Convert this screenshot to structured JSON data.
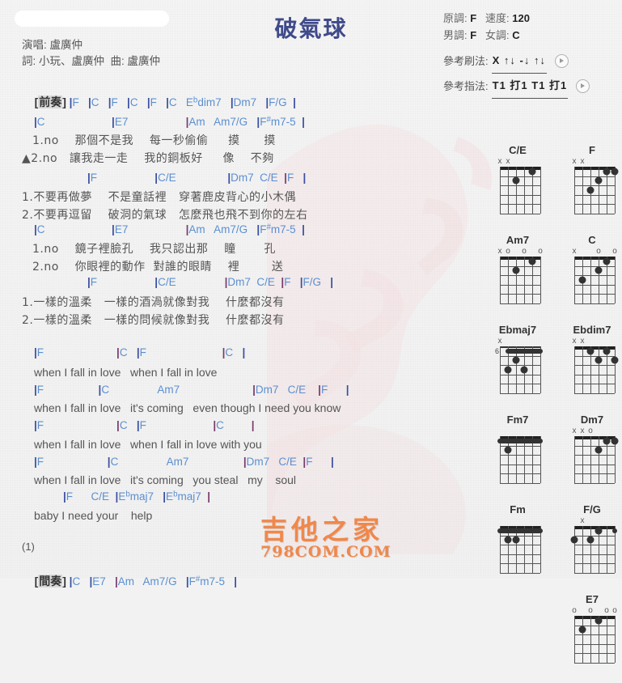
{
  "header": {
    "title": "破氣球",
    "redacted_bar": "",
    "credits": [
      "演唱: 盧廣仲",
      "詞: 小玩、盧廣仲  曲: 盧廣仲"
    ],
    "meta": [
      {
        "label1": "原調:",
        "value1": "F",
        "label2": "速度:",
        "value2": "120"
      },
      {
        "label1": "男調:",
        "value1": "F",
        "label2": "女調:",
        "value2": "C"
      }
    ],
    "strum": {
      "label": "參考刷法:",
      "pattern": "X ↑↓ -↓ ↑↓",
      "play_icon": "play-icon"
    },
    "fingerstyle": {
      "label": "參考指法:",
      "pattern": "T1 打1 T1 打1",
      "play_icon": "play-icon"
    }
  },
  "sections": {
    "intro": {
      "label": "[前奏]",
      "chords": "|F   |C   |F   |C   |F   |C   E♭dim7   |Dm7   |F/G   |"
    },
    "verse1": {
      "line1_chords": "|C                |E7             |Am   Am7/G   |F♯m7-5  |",
      "line1_lyrics": [
        "1.no    那個不是我    每一秒偷偷     摸      摸",
        "▲2.no   讓我走一走    我的銅板好     像    不夠"
      ],
      "line2_chords": "|F              |C/E          |Dm7  C/E  |F   |",
      "line2_lyrics": [
        "1.不要再做夢    不是童話裡   穿著鹿皮背心的小木偶",
        "2.不要再逗留    破洞的氣球   怎麼飛也飛不到你的左右"
      ]
    },
    "verse2": {
      "line1_chords": "|C                |E7             |Am   Am7/G   |F♯m7-5  |",
      "line1_lyrics": [
        "1.no    鏡子裡臉孔    我只認出那    瞳       孔",
        "2.no    你眼裡的動作  對誰的眼睛    裡        送"
      ],
      "line2_chords": "|F              |C/E          |Dm7  C/E  |F   |F/G   |",
      "line2_lyrics": [
        "1.一樣的溫柔   一樣的酒渦就像對我    什麼都沒有",
        "2.一樣的溫柔   一樣的問候就像對我    什麼都沒有"
      ]
    },
    "chorus": [
      {
        "chords": "|F             |C   |F            |C    |",
        "lyrics": "when I fall in love   when I fall in love"
      },
      {
        "chords": "|F           |C        Am7            |Dm7   C/E    |F        |",
        "lyrics": "when I fall in love   it's coming   even though I need you know"
      },
      {
        "chords": "|F            |C   |F          |C         |",
        "lyrics": "when I fall in love   when I fall in love with you"
      },
      {
        "chords": "|F          |C       Am7        |Dm7  C/E  |F     |",
        "lyrics": "when I fall in love   it's coming   you steal   my    soul"
      },
      {
        "chords": "|F     C/E  |E♭maj7  |E♭maj7  |",
        "lyrics": "baby I need your    help"
      }
    ],
    "repeat_marker": "(1)",
    "interlude": {
      "label": "[間奏]",
      "chords": "|C   |E7   |Am   Am7/G   |F♯m7-5   |"
    }
  },
  "chord_diagrams": [
    {
      "name": "C/E",
      "marks": [
        "x",
        "x",
        "",
        "",
        "",
        ""
      ],
      "start_fret": "",
      "dots": [
        [
          3,
          2
        ],
        [
          5,
          1
        ]
      ],
      "barre": null
    },
    {
      "name": "F",
      "marks": [
        "x",
        "x",
        "",
        "",
        "",
        ""
      ],
      "start_fret": "",
      "dots": [
        [
          3,
          3
        ],
        [
          4,
          2
        ],
        [
          5,
          1
        ],
        [
          6,
          1
        ]
      ],
      "barre": null
    },
    {
      "name": "Am7",
      "marks": [
        "x",
        "o",
        "",
        "o",
        "",
        "o"
      ],
      "start_fret": "",
      "dots": [
        [
          3,
          2
        ],
        [
          5,
          1
        ]
      ],
      "barre": null
    },
    {
      "name": "C",
      "marks": [
        "x",
        "",
        "",
        "o",
        "",
        "o"
      ],
      "start_fret": "",
      "dots": [
        [
          2,
          3
        ],
        [
          4,
          2
        ],
        [
          5,
          1
        ]
      ],
      "barre": null
    },
    {
      "name": "Ebmaj7",
      "marks": [
        "x",
        "",
        "",
        "",
        "",
        ""
      ],
      "start_fret": "6",
      "dots": [
        [
          3,
          2
        ],
        [
          2,
          3
        ],
        [
          4,
          3
        ]
      ],
      "barre": {
        "fret": 1,
        "from": 2,
        "to": 6
      }
    },
    {
      "name": "Ebdim7",
      "marks": [
        "x",
        "x",
        "",
        "",
        "",
        ""
      ],
      "start_fret": "",
      "dots": [
        [
          3,
          1
        ],
        [
          4,
          2
        ],
        [
          5,
          1
        ],
        [
          6,
          2
        ]
      ],
      "barre": null
    },
    {
      "name": "Fm7",
      "marks": [
        "",
        "",
        "",
        "",
        "",
        ""
      ],
      "start_fret": "",
      "dots": [
        [
          2,
          2
        ]
      ],
      "barre": {
        "fret": 1,
        "from": 1,
        "to": 6
      }
    },
    {
      "name": "Dm7",
      "marks": [
        "x",
        "x",
        "o",
        "",
        "",
        ""
      ],
      "start_fret": "",
      "dots": [
        [
          4,
          2
        ],
        [
          5,
          1
        ],
        [
          6,
          1
        ]
      ],
      "barre": null
    },
    {
      "name": "Fm",
      "marks": [
        "",
        "",
        "",
        "",
        "",
        ""
      ],
      "start_fret": "",
      "dots": [
        [
          2,
          2
        ],
        [
          3,
          2
        ]
      ],
      "barre": {
        "fret": 1,
        "from": 1,
        "to": 6
      }
    },
    {
      "name": "F/G",
      "marks": [
        "",
        "x",
        "",
        "",
        "",
        ""
      ],
      "start_fret": "",
      "dots": [
        [
          1,
          2
        ],
        [
          3,
          2
        ],
        [
          4,
          1
        ]
      ],
      "barre": {
        "fret": 1,
        "from": 6,
        "to": 6
      }
    },
    {
      "name": "E7",
      "marks": [
        "o",
        "",
        "o",
        "",
        "o",
        "o"
      ],
      "start_fret": "",
      "dots": [
        [
          2,
          2
        ],
        [
          4,
          1
        ]
      ],
      "barre": null
    }
  ],
  "watermark": {
    "brand_cn": "吉他之家",
    "brand_en": "798COM.COM",
    "color": "#f0884a"
  },
  "colors": {
    "title": "#3f4a8a",
    "chord": "#5b8fd0",
    "bar": "#3a4fa0",
    "lyric": "#555555",
    "background": "#f2f2f2"
  }
}
